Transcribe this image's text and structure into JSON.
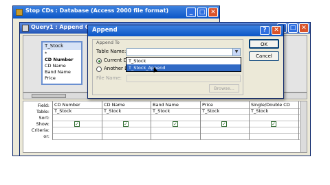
{
  "db_window": {
    "title": "Stop CDs : Database (Access 2000 file format)"
  },
  "query_window": {
    "title": "Query1 : Append Query"
  },
  "field_list": {
    "title": "T_Stock",
    "items": [
      "*",
      "CD Number",
      "CD Name",
      "Band Name",
      "Price"
    ]
  },
  "grid": {
    "row_labels": [
      "Field:",
      "Table:",
      "Sort:",
      "Show:",
      "Criteria:",
      "or:"
    ],
    "columns": [
      {
        "field": "CD Number",
        "table": "T_Stock",
        "show": true
      },
      {
        "field": "CD Name",
        "table": "T_Stock",
        "show": true
      },
      {
        "field": "Band Name",
        "table": "T_Stock",
        "show": true
      },
      {
        "field": "Price",
        "table": "T_Stock",
        "show": true
      },
      {
        "field": "Single/Double CD",
        "table": "T_Stock",
        "show": true
      }
    ]
  },
  "dialog": {
    "title": "Append",
    "help_label": "?",
    "close_label": "✕",
    "append_to_label": "Append To",
    "table_name_label": "Table Name:",
    "table_name_value": "",
    "current_db_label": "Current Da",
    "another_db_label": "Another Database:",
    "file_name_label": "File Name:",
    "browse_label": "Browse...",
    "ok_label": "OK",
    "cancel_label": "Cancel",
    "dropdown_items": [
      "T_Stock",
      "T_Stock_Append"
    ],
    "dropdown_selected": "T_Stock_Append"
  }
}
